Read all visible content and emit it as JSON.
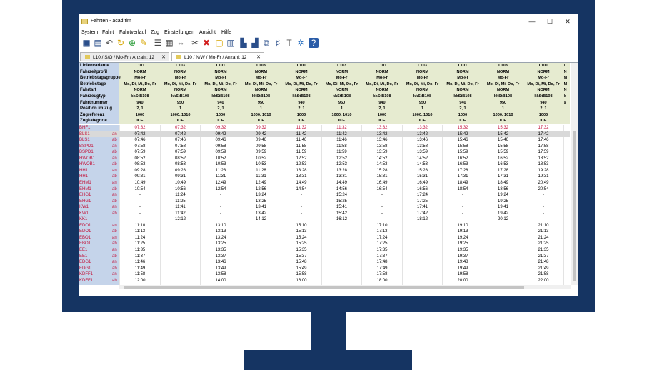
{
  "window": {
    "title": "Fahrten - acad.tim",
    "minimize": "—",
    "maximize": "☐",
    "close": "✕"
  },
  "menu": [
    "System",
    "Fahrt",
    "Fahrtverlauf",
    "Zug",
    "Einstellungen",
    "Ansicht",
    "Hilfe"
  ],
  "toolbar_icons": [
    "save-icon",
    "save-as-icon",
    "undo-icon",
    "refresh-icon",
    "add-icon",
    "edit-icon",
    "list-icon",
    "grid-icon",
    "expand-icon",
    "cut-icon",
    "delete-icon",
    "new-document-icon",
    "table-icon",
    "train-icon",
    "train-alt-icon",
    "copy-icon",
    "chart-icon",
    "text-icon",
    "network-icon",
    "help-icon"
  ],
  "tabs": [
    {
      "label": "L10 / S/O / Mo-Fr / Anzahl: 12",
      "close": "✕"
    },
    {
      "label": "L10 / N/W / Mo-Fr / Anzahl: 12",
      "close": "✕"
    }
  ],
  "header_rows": [
    {
      "label": "Linienvariante",
      "values": [
        "L101",
        "L103",
        "L101",
        "L103",
        "L101",
        "L103",
        "L101",
        "L103",
        "L101",
        "L103",
        "L101",
        "L"
      ]
    },
    {
      "label": "Fahrzeitprofil",
      "values": [
        "NORM",
        "NORM",
        "NORM",
        "NORM",
        "NORM",
        "NORM",
        "NORM",
        "NORM",
        "NORM",
        "NORM",
        "NORM",
        "N"
      ]
    },
    {
      "label": "Betriebstagsgruppe",
      "values": [
        "Mo-Fr",
        "Mo-Fr",
        "Mo-Fr",
        "Mo-Fr",
        "Mo-Fr",
        "Mo-Fr",
        "Mo-Fr",
        "Mo-Fr",
        "Mo-Fr",
        "Mo-Fr",
        "Mo-Fr",
        "M"
      ]
    },
    {
      "label": "Betriebstage",
      "values": [
        "Mo, Di, Mi, Do, Fr",
        "Mo, Di, Mi, Do, Fr",
        "Mo, Di, Mi, Do, Fr",
        "Mo, Di, Mi, Do, Fr",
        "Mo, Di, Mi, Do, Fr",
        "Mo, Di, Mi, Do, Fr",
        "Mo, Di, Mi, Do, Fr",
        "Mo, Di, Mi, Do, Fr",
        "Mo, Di, Mi, Do, Fr",
        "Mo, Di, Mi, Do, Fr",
        "Mo, Di, Mi, Do, Fr",
        "M"
      ]
    },
    {
      "label": "Fahrtart",
      "values": [
        "NORM",
        "NORM",
        "NORM",
        "NORM",
        "NORM",
        "NORM",
        "NORM",
        "NORM",
        "NORM",
        "NORM",
        "NORM",
        "N"
      ]
    },
    {
      "label": "Fahrzeugtyp",
      "values": [
        "kkStB108",
        "kkStB108",
        "kkStB108",
        "kkStB108",
        "kkStB108",
        "kkStB108",
        "kkStB108",
        "kkStB108",
        "kkStB108",
        "kkStB108",
        "kkStB108",
        "k"
      ]
    },
    {
      "label": "Fahrtnummer",
      "values": [
        "940",
        "950",
        "940",
        "950",
        "940",
        "950",
        "940",
        "950",
        "940",
        "950",
        "940",
        "9"
      ]
    },
    {
      "label": "Position im Zug",
      "values": [
        "2, 1",
        "1",
        "2, 1",
        "1",
        "2, 1",
        "1",
        "2, 1",
        "1",
        "2, 1",
        "1",
        "2, 1",
        ""
      ]
    },
    {
      "label": "Zugreferenz",
      "values": [
        "1000",
        "1000, 1010",
        "1000",
        "1000, 1010",
        "1000",
        "1000, 1010",
        "1000",
        "1000, 1010",
        "1000",
        "1000, 1010",
        "1000",
        ""
      ]
    },
    {
      "label": "Zugkategorie",
      "values": [
        "ICE",
        "ICE",
        "ICE",
        "ICE",
        "ICE",
        "ICE",
        "ICE",
        "ICE",
        "ICE",
        "ICE",
        "ICE",
        ""
      ]
    }
  ],
  "stop_rows": [
    {
      "station": "BHF1",
      "type": "",
      "times": [
        "07:32",
        "07:32",
        "09:32",
        "09:32",
        "11:32",
        "11:32",
        "13:32",
        "13:32",
        "15:32",
        "15:32",
        "17:32"
      ],
      "highlight": "red"
    },
    {
      "station": "BLS1",
      "type": "an",
      "times": [
        "07:42",
        "07:42",
        "09:42",
        "09:42",
        "11:42",
        "11:42",
        "13:42",
        "13:42",
        "15:42",
        "15:42",
        "17:42"
      ],
      "highlight": "selected"
    },
    {
      "station": "BLS1",
      "type": "ab",
      "times": [
        "07:46",
        "07:46",
        "09:46",
        "09:46",
        "11:46",
        "11:46",
        "13:46",
        "13:46",
        "15:46",
        "15:46",
        "17:46"
      ]
    },
    {
      "station": "BSPD1",
      "type": "an",
      "times": [
        "07:58",
        "07:58",
        "09:58",
        "09:58",
        "11:58",
        "11:58",
        "13:58",
        "13:58",
        "15:58",
        "15:58",
        "17:58"
      ]
    },
    {
      "station": "BSPD1",
      "type": "ab",
      "times": [
        "07:59",
        "07:59",
        "09:59",
        "09:59",
        "11:59",
        "11:59",
        "13:59",
        "13:59",
        "15:59",
        "15:59",
        "17:59"
      ]
    },
    {
      "station": "HWOB1",
      "type": "an",
      "times": [
        "08:52",
        "08:52",
        "10:52",
        "10:52",
        "12:52",
        "12:52",
        "14:52",
        "14:52",
        "16:52",
        "16:52",
        "18:52"
      ]
    },
    {
      "station": "HWOB1",
      "type": "ab",
      "times": [
        "08:53",
        "08:53",
        "10:53",
        "10:53",
        "12:53",
        "12:53",
        "14:53",
        "14:53",
        "16:53",
        "16:53",
        "18:53"
      ]
    },
    {
      "station": "HH1",
      "type": "an",
      "times": [
        "09:28",
        "09:28",
        "11:28",
        "11:28",
        "13:28",
        "13:28",
        "15:28",
        "15:28",
        "17:28",
        "17:28",
        "19:28"
      ]
    },
    {
      "station": "HH1",
      "type": "ab",
      "times": [
        "09:31",
        "09:31",
        "11:31",
        "11:31",
        "13:31",
        "13:31",
        "15:31",
        "15:31",
        "17:31",
        "17:31",
        "19:31"
      ]
    },
    {
      "station": "EHM1",
      "type": "an",
      "times": [
        "10:49",
        "10:49",
        "12:49",
        "12:49",
        "14:49",
        "14:49",
        "16:49",
        "16:49",
        "18:49",
        "18:49",
        "20:49"
      ]
    },
    {
      "station": "EHM1",
      "type": "ab",
      "times": [
        "10:54",
        "10:56",
        "12:54",
        "12:56",
        "14:54",
        "14:56",
        "16:54",
        "16:56",
        "18:54",
        "18:56",
        "20:54"
      ]
    },
    {
      "station": "EHG1",
      "type": "an",
      "times": [
        "-",
        "11:24",
        "-",
        "13:24",
        "-",
        "15:24",
        "-",
        "17:24",
        "-",
        "19:24",
        "-"
      ]
    },
    {
      "station": "EHG1",
      "type": "ab",
      "times": [
        "-",
        "11:25",
        "-",
        "13:25",
        "-",
        "15:25",
        "-",
        "17:25",
        "-",
        "19:25",
        "-"
      ]
    },
    {
      "station": "KW1",
      "type": "an",
      "times": [
        "-",
        "11:41",
        "-",
        "13:41",
        "-",
        "15:41",
        "-",
        "17:41",
        "-",
        "19:41",
        "-"
      ]
    },
    {
      "station": "KW1",
      "type": "ab",
      "times": [
        "-",
        "11:42",
        "-",
        "13:42",
        "-",
        "15:42",
        "-",
        "17:42",
        "-",
        "19:42",
        "-"
      ]
    },
    {
      "station": "KK1",
      "type": "",
      "times": [
        "-",
        "12:12",
        "-",
        "14:12",
        "-",
        "16:12",
        "-",
        "18:12",
        "-",
        "20:12",
        "-"
      ]
    },
    {
      "station": "EDO1",
      "type": "an",
      "times": [
        "11:10",
        "",
        "13:10",
        "",
        "15:10",
        "",
        "17:10",
        "",
        "19:10",
        "",
        "21:10"
      ]
    },
    {
      "station": "EDO1",
      "type": "ab",
      "times": [
        "11:13",
        "",
        "13:13",
        "",
        "15:13",
        "",
        "17:13",
        "",
        "19:13",
        "",
        "21:13"
      ]
    },
    {
      "station": "EBO1",
      "type": "an",
      "times": [
        "11:24",
        "",
        "13:24",
        "",
        "15:24",
        "",
        "17:24",
        "",
        "19:24",
        "",
        "21:24"
      ]
    },
    {
      "station": "EBO1",
      "type": "ab",
      "times": [
        "11:25",
        "",
        "13:25",
        "",
        "15:25",
        "",
        "17:25",
        "",
        "19:25",
        "",
        "21:25"
      ]
    },
    {
      "station": "EE1",
      "type": "an",
      "times": [
        "11:35",
        "",
        "13:35",
        "",
        "15:35",
        "",
        "17:35",
        "",
        "19:35",
        "",
        "21:35"
      ]
    },
    {
      "station": "EE1",
      "type": "ab",
      "times": [
        "11:37",
        "",
        "13:37",
        "",
        "15:37",
        "",
        "17:37",
        "",
        "19:37",
        "",
        "21:37"
      ]
    },
    {
      "station": "EDG1",
      "type": "an",
      "times": [
        "11:46",
        "",
        "13:46",
        "",
        "15:48",
        "",
        "17:48",
        "",
        "19:48",
        "",
        "21:48"
      ]
    },
    {
      "station": "EDG1",
      "type": "ab",
      "times": [
        "11:49",
        "",
        "13:49",
        "",
        "15:49",
        "",
        "17:49",
        "",
        "19:49",
        "",
        "21:49"
      ]
    },
    {
      "station": "KDFF1",
      "type": "an",
      "times": [
        "11:58",
        "",
        "13:58",
        "",
        "15:58",
        "",
        "17:58",
        "",
        "19:58",
        "",
        "21:58"
      ]
    },
    {
      "station": "KDFF1",
      "type": "ab",
      "times": [
        "12:00",
        "",
        "14:00",
        "",
        "16:00",
        "",
        "18:00",
        "",
        "20:00",
        "",
        "22:00"
      ]
    }
  ],
  "colors": {
    "monitor": "#153462",
    "label_bg": "#c5d4ea",
    "header_bg": "#e6ebd0",
    "station_text": "#c2133a",
    "selected_row": "#d9d9d9"
  }
}
